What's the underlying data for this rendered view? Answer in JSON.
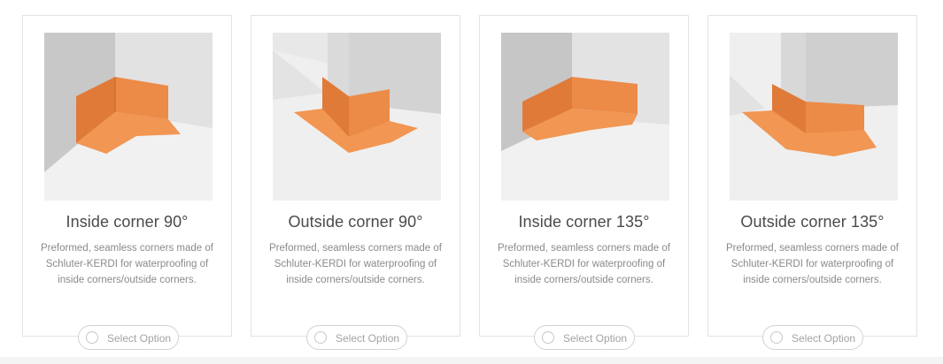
{
  "products": [
    {
      "title": "Inside corner 90°",
      "description": "Preformed, seamless corners made of Schluter-KERDI for waterproofing of inside corners/outside corners.",
      "button_label": "Select Option"
    },
    {
      "title": "Outside corner 90°",
      "description": "Preformed, seamless corners made of Schluter-KERDI for waterproofing of inside corners/outside corners.",
      "button_label": "Select Option"
    },
    {
      "title": "Inside corner 135°",
      "description": "Preformed, seamless corners made of Schluter-KERDI for waterproofing of inside corners/outside corners.",
      "button_label": "Select Option"
    },
    {
      "title": "Outside corner 135°",
      "description": "Preformed, seamless corners made of Schluter-KERDI for waterproofing of inside corners/outside corners.",
      "button_label": "Select Option"
    }
  ],
  "colors": {
    "membrane": "#e8813f",
    "wall": "#d6d6d6",
    "floor": "#efefef"
  }
}
